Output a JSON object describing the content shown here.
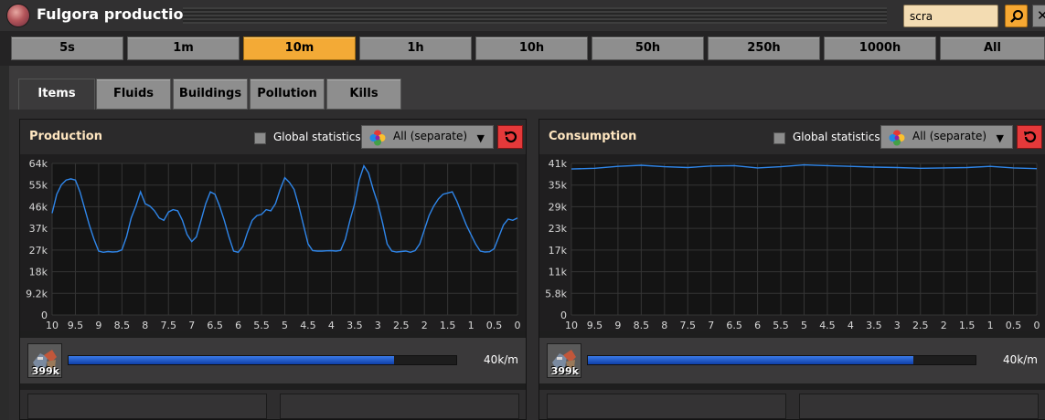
{
  "window": {
    "title": "Fulgora production"
  },
  "search": {
    "value": "scra"
  },
  "time_ranges": [
    {
      "label": "5s",
      "active": false
    },
    {
      "label": "1m",
      "active": false
    },
    {
      "label": "10m",
      "active": true
    },
    {
      "label": "1h",
      "active": false
    },
    {
      "label": "10h",
      "active": false
    },
    {
      "label": "50h",
      "active": false
    },
    {
      "label": "250h",
      "active": false
    },
    {
      "label": "1000h",
      "active": false
    },
    {
      "label": "All",
      "active": false
    }
  ],
  "tabs": [
    {
      "label": "Items",
      "active": true
    },
    {
      "label": "Fluids",
      "active": false
    },
    {
      "label": "Buildings",
      "active": false
    },
    {
      "label": "Pollution",
      "active": false
    },
    {
      "label": "Kills",
      "active": false
    }
  ],
  "colors": {
    "line": "#2f86ea",
    "accent": "#f3aa36",
    "reset": "#e5393a",
    "rate_fill": "#1f5fd8"
  },
  "panels": [
    {
      "title": "Production",
      "global_label": "Global statistics",
      "dropdown": {
        "label": "All (separate)",
        "icon": "color-wheel-icon"
      },
      "reset_icon": "reset-icon",
      "item": {
        "icon": "scrap-icon",
        "count": "399k",
        "rate": "40k/m",
        "rate_fraction": 0.84
      },
      "chart_data": {
        "type": "line",
        "x_reversed": true,
        "xlim": [
          10,
          0
        ],
        "ylim": [
          0,
          64000
        ],
        "yticks": [
          "64k",
          "55k",
          "46k",
          "37k",
          "27k",
          "18k",
          "9.2k",
          "0"
        ],
        "xticks": [
          "10",
          "9.5",
          "9",
          "8.5",
          "8",
          "7.5",
          "7",
          "6.5",
          "6",
          "5.5",
          "5",
          "4.5",
          "4",
          "3.5",
          "3",
          "2.5",
          "2",
          "1.5",
          "1",
          "0.5",
          "0"
        ],
        "series": [
          {
            "x": [
              10,
              9.9,
              9.8,
              9.7,
              9.6,
              9.5,
              9.4,
              9.3,
              9.2,
              9.1,
              9.0,
              8.9,
              8.8,
              8.7,
              8.6,
              8.5,
              8.4,
              8.3,
              8.2,
              8.1,
              8.0,
              7.9,
              7.8,
              7.7,
              7.6,
              7.5,
              7.4,
              7.3,
              7.2,
              7.1,
              7.0,
              6.9,
              6.8,
              6.7,
              6.6,
              6.5,
              6.4,
              6.3,
              6.2,
              6.1,
              6.0,
              5.9,
              5.8,
              5.7,
              5.6,
              5.5,
              5.4,
              5.3,
              5.2,
              5.1,
              5.0,
              4.9,
              4.8,
              4.7,
              4.6,
              4.5,
              4.4,
              4.3,
              4.2,
              4.1,
              4.0,
              3.9,
              3.8,
              3.7,
              3.6,
              3.5,
              3.4,
              3.3,
              3.2,
              3.1,
              3.0,
              2.9,
              2.8,
              2.7,
              2.6,
              2.5,
              2.4,
              2.3,
              2.2,
              2.1,
              2.0,
              1.9,
              1.8,
              1.7,
              1.6,
              1.5,
              1.4,
              1.3,
              1.2,
              1.1,
              1.0,
              0.9,
              0.8,
              0.7,
              0.6,
              0.5,
              0.4,
              0.3,
              0.2,
              0.1,
              0.0
            ],
            "y": [
              43000,
              51000,
              55000,
              57000,
              57500,
              57000,
              52000,
              45000,
              38000,
              32000,
              27000,
              26500,
              26800,
              26600,
              26700,
              27500,
              33000,
              41000,
              46000,
              52000,
              47000,
              46000,
              44000,
              41000,
              40000,
              43500,
              44500,
              44000,
              40000,
              34000,
              31000,
              33000,
              40000,
              47000,
              52000,
              51000,
              46000,
              40000,
              33000,
              27000,
              26500,
              29000,
              35000,
              40000,
              42000,
              42500,
              44500,
              44000,
              47000,
              53000,
              58000,
              56000,
              53000,
              46000,
              38000,
              30000,
              27200,
              27000,
              27000,
              27100,
              27200,
              27000,
              27300,
              32000,
              40000,
              47000,
              57000,
              63000,
              60000,
              53000,
              47000,
              39000,
              30000,
              27000,
              26600,
              26800,
              27000,
              26500,
              27200,
              30000,
              36000,
              42000,
              46000,
              49000,
              51000,
              51500,
              52000,
              48000,
              43000,
              38000,
              34000,
              30000,
              27000,
              26600,
              26700,
              28000,
              33000,
              38000,
              40500,
              40000,
              41000
            ]
          }
        ]
      }
    },
    {
      "title": "Consumption",
      "global_label": "Global statistics",
      "dropdown": {
        "label": "All (separate)",
        "icon": "color-wheel-icon"
      },
      "reset_icon": "reset-icon",
      "item": {
        "icon": "scrap-icon",
        "count": "399k",
        "rate": "40k/m",
        "rate_fraction": 0.84
      },
      "chart_data": {
        "type": "line",
        "x_reversed": true,
        "xlim": [
          10,
          0
        ],
        "ylim": [
          0,
          41000
        ],
        "yticks": [
          "41k",
          "35k",
          "29k",
          "23k",
          "17k",
          "11k",
          "5.8k",
          "0"
        ],
        "xticks": [
          "10",
          "9.5",
          "9",
          "8.5",
          "8",
          "7.5",
          "7",
          "6.5",
          "6",
          "5.5",
          "5",
          "4.5",
          "4",
          "3.5",
          "3",
          "2.5",
          "2",
          "1.5",
          "1",
          "0.5",
          "0"
        ],
        "series": [
          {
            "x": [
              10,
              9.5,
              9,
              8.5,
              8,
              7.5,
              7,
              6.5,
              6,
              5.5,
              5,
              4.5,
              4,
              3.5,
              3,
              2.5,
              2,
              1.5,
              1,
              0.5,
              0
            ],
            "y": [
              39500,
              39700,
              40200,
              40500,
              40100,
              39900,
              40300,
              40400,
              39800,
              40100,
              40600,
              40400,
              40200,
              40000,
              39900,
              39700,
              39800,
              39900,
              40200,
              39800,
              39600
            ]
          }
        ]
      }
    }
  ]
}
